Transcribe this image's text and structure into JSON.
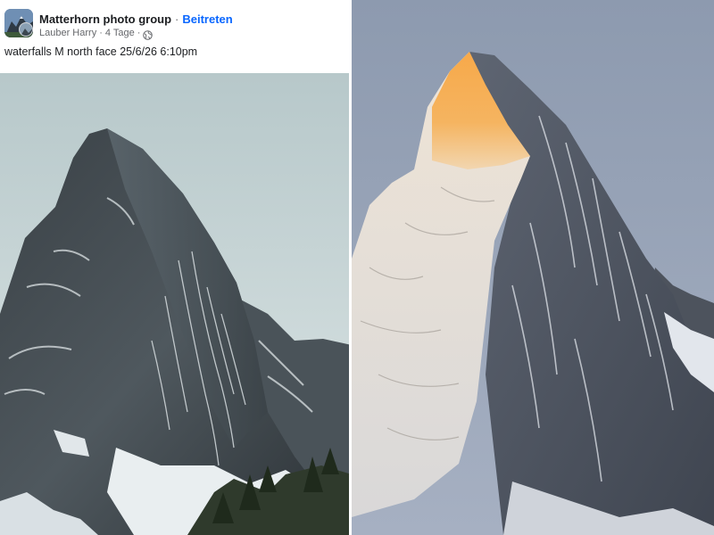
{
  "post": {
    "group_name": "Matterhorn photo group",
    "separator": "·",
    "join_label": "Beitreten",
    "author": "Lauber Harry",
    "age": "· 4 Tage ·",
    "text": "waterfalls M north face 25/6/26 6:10pm"
  },
  "icons": {
    "privacy": "globe-icon",
    "group": "group-avatar-icon"
  },
  "colors": {
    "link": "#0866ff",
    "primary_text": "#1c1e21",
    "secondary_text": "#65676b",
    "alpenglow": "#f29a3a",
    "right_sky": "#8d9cb0",
    "left_sky": "#b9c9cb"
  }
}
